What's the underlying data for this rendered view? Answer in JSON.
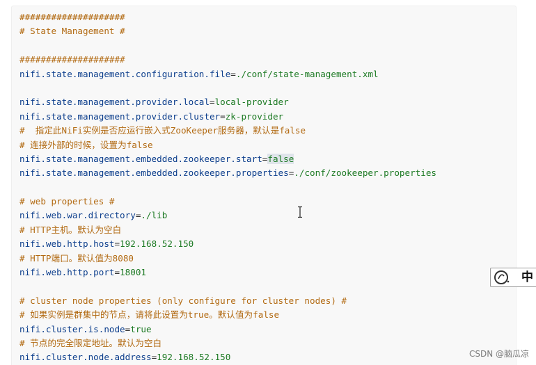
{
  "code": {
    "lines": [
      {
        "segments": [
          {
            "t": "####################",
            "c": "comment"
          }
        ]
      },
      {
        "segments": [
          {
            "t": "# State Management #",
            "c": "comment"
          }
        ]
      },
      {
        "segments": []
      },
      {
        "segments": [
          {
            "t": "####################",
            "c": "comment"
          }
        ]
      },
      {
        "segments": [
          {
            "t": "nifi.state.management.configuration.file",
            "c": "key"
          },
          {
            "t": "=",
            "c": "eq"
          },
          {
            "t": "./conf/state-management.xml",
            "c": "val"
          }
        ]
      },
      {
        "segments": []
      },
      {
        "segments": [
          {
            "t": "nifi.state.management.provider.local",
            "c": "key"
          },
          {
            "t": "=",
            "c": "eq"
          },
          {
            "t": "local-provider",
            "c": "val"
          }
        ]
      },
      {
        "segments": [
          {
            "t": "nifi.state.management.provider.cluster",
            "c": "key"
          },
          {
            "t": "=",
            "c": "eq"
          },
          {
            "t": "zk-provider",
            "c": "val"
          }
        ]
      },
      {
        "segments": [
          {
            "t": "#  指定此NiFi实例是否应运行嵌入式ZooKeeper服务器，默认是false",
            "c": "comment"
          }
        ]
      },
      {
        "segments": [
          {
            "t": "# 连接外部的时候，设置为false",
            "c": "comment"
          }
        ]
      },
      {
        "segments": [
          {
            "t": "nifi.state.management.embedded.zookeeper.start",
            "c": "key"
          },
          {
            "t": "=",
            "c": "eq"
          },
          {
            "t": "false",
            "c": "val-hl"
          }
        ]
      },
      {
        "segments": [
          {
            "t": "nifi.state.management.embedded.zookeeper.properties",
            "c": "key"
          },
          {
            "t": "=",
            "c": "eq"
          },
          {
            "t": "./conf/zookeeper.properties",
            "c": "val"
          }
        ]
      },
      {
        "segments": []
      },
      {
        "segments": [
          {
            "t": "# web properties #",
            "c": "comment"
          }
        ]
      },
      {
        "segments": [
          {
            "t": "nifi.web.war.directory",
            "c": "key"
          },
          {
            "t": "=",
            "c": "eq"
          },
          {
            "t": "./lib",
            "c": "val"
          }
        ]
      },
      {
        "segments": [
          {
            "t": "# HTTP主机。默认为空白",
            "c": "comment"
          }
        ]
      },
      {
        "segments": [
          {
            "t": "nifi.web.http.host",
            "c": "key"
          },
          {
            "t": "=",
            "c": "eq"
          },
          {
            "t": "192.168.52.150",
            "c": "val"
          }
        ]
      },
      {
        "segments": [
          {
            "t": "# HTTP端口。默认值为8080",
            "c": "comment"
          }
        ]
      },
      {
        "segments": [
          {
            "t": "nifi.web.http.port",
            "c": "key"
          },
          {
            "t": "=",
            "c": "eq"
          },
          {
            "t": "18001",
            "c": "val"
          }
        ]
      },
      {
        "segments": []
      },
      {
        "segments": [
          {
            "t": "# cluster node properties (only configure for cluster nodes) #",
            "c": "comment"
          }
        ]
      },
      {
        "segments": [
          {
            "t": "# 如果实例是群集中的节点，请将此设置为true。默认值为false",
            "c": "comment"
          }
        ]
      },
      {
        "segments": [
          {
            "t": "nifi.cluster.is.node",
            "c": "key"
          },
          {
            "t": "=",
            "c": "eq"
          },
          {
            "t": "true",
            "c": "val"
          }
        ]
      },
      {
        "segments": [
          {
            "t": "# 节点的完全限定地址。默认为空白",
            "c": "comment"
          }
        ]
      },
      {
        "segments": [
          {
            "t": "nifi.cluster.node.address",
            "c": "key"
          },
          {
            "t": "=",
            "c": "eq"
          },
          {
            "t": "192.168.52.150",
            "c": "val"
          }
        ]
      }
    ]
  },
  "ime": {
    "mode_label": "中"
  },
  "watermark": "CSDN @脑瓜凉",
  "icons": {
    "cursor": "text-cursor-icon",
    "ime_logo": "ime-logo-icon"
  },
  "colors": {
    "comment": "#b26a12",
    "key": "#0c3e8c",
    "value": "#1d7a24",
    "background": "#f8f8f8"
  }
}
